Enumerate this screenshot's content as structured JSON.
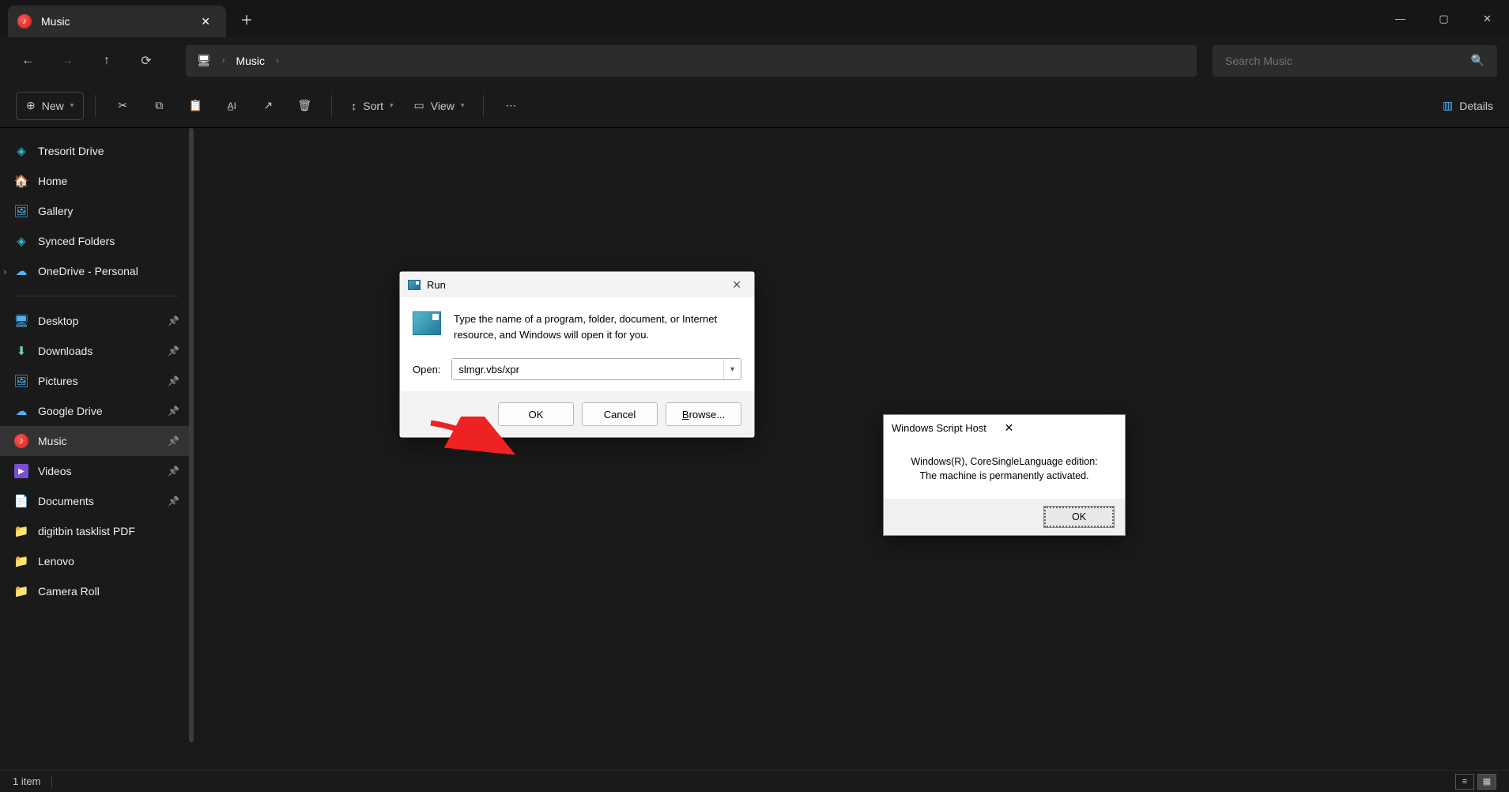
{
  "window": {
    "tab_title": "Music",
    "minimize": "—",
    "maximize": "▢",
    "close": "✕"
  },
  "nav": {
    "breadcrumb_root_icon": "monitor",
    "breadcrumb_item": "Music"
  },
  "search": {
    "placeholder": "Search Music"
  },
  "toolbar": {
    "new_label": "New",
    "sort_label": "Sort",
    "view_label": "View",
    "details_label": "Details"
  },
  "sidebar": {
    "items": [
      {
        "label": "Tresorit Drive",
        "icon": "cube",
        "color": "ic-teal",
        "pinned": false
      },
      {
        "label": "Home",
        "icon": "home",
        "color": "",
        "pinned": false
      },
      {
        "label": "Gallery",
        "icon": "gallery",
        "color": "ic-blue",
        "pinned": false
      },
      {
        "label": "Synced Folders",
        "icon": "cube",
        "color": "ic-teal",
        "pinned": false
      },
      {
        "label": "OneDrive - Personal",
        "icon": "cloud",
        "color": "ic-blue",
        "pinned": false,
        "expandable": true
      }
    ],
    "items2": [
      {
        "label": "Desktop",
        "icon": "desktop",
        "color": "ic-blue",
        "pinned": true
      },
      {
        "label": "Downloads",
        "icon": "download",
        "color": "ic-green",
        "pinned": true
      },
      {
        "label": "Pictures",
        "icon": "pictures",
        "color": "ic-blue",
        "pinned": true
      },
      {
        "label": "Google Drive",
        "icon": "cloud",
        "color": "ic-blue",
        "pinned": true
      },
      {
        "label": "Music",
        "icon": "music",
        "color": "",
        "pinned": true,
        "active": true
      },
      {
        "label": "Videos",
        "icon": "video",
        "color": "",
        "pinned": true
      },
      {
        "label": "Documents",
        "icon": "doc",
        "color": "ic-blue",
        "pinned": true
      },
      {
        "label": "digitbin tasklist PDF",
        "icon": "folder",
        "color": "ic-yellow",
        "pinned": false
      },
      {
        "label": "Lenovo",
        "icon": "folder",
        "color": "ic-yellow",
        "pinned": false
      },
      {
        "label": "Camera Roll",
        "icon": "folder",
        "color": "ic-yellow",
        "pinned": false
      }
    ]
  },
  "status": {
    "text": "1 item"
  },
  "run_dialog": {
    "title": "Run",
    "description": "Type the name of a program, folder, document, or Internet resource, and Windows will open it for you.",
    "open_label": "Open:",
    "value": "slmgr.vbs/xpr",
    "ok": "OK",
    "cancel": "Cancel",
    "browse": "Browse..."
  },
  "wsh_dialog": {
    "title": "Windows Script Host",
    "line1": "Windows(R), CoreSingleLanguage edition:",
    "line2": "The machine is permanently activated.",
    "ok": "OK"
  }
}
